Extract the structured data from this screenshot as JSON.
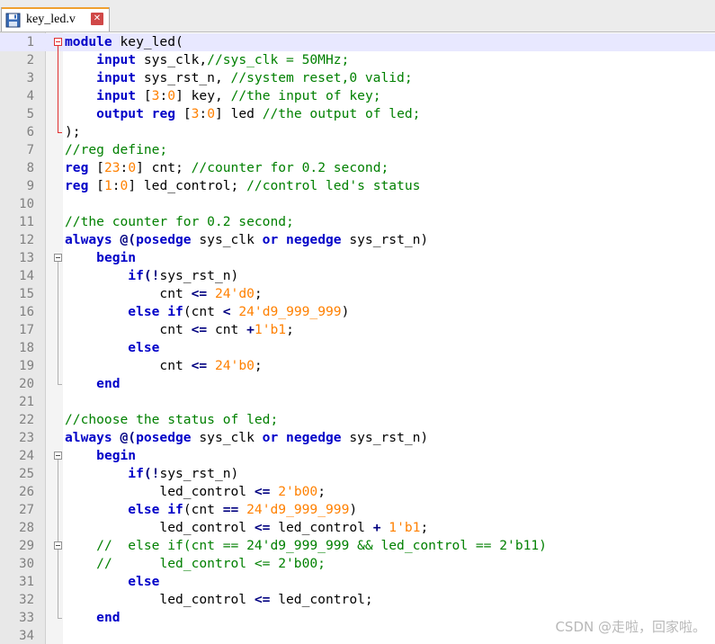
{
  "tab": {
    "file_name": "key_led.v"
  },
  "lines": [
    [
      {
        "t": "module",
        "c": "kw"
      },
      {
        "t": " key_led("
      }
    ],
    [
      {
        "t": "    "
      },
      {
        "t": "input",
        "c": "kw"
      },
      {
        "t": " sys_clk,"
      },
      {
        "t": "//sys_clk = 50MHz;",
        "c": "cm"
      }
    ],
    [
      {
        "t": "    "
      },
      {
        "t": "input",
        "c": "kw"
      },
      {
        "t": " sys_rst_n, "
      },
      {
        "t": "//system reset,0 valid;",
        "c": "cm"
      }
    ],
    [
      {
        "t": "    "
      },
      {
        "t": "input",
        "c": "kw"
      },
      {
        "t": " ["
      },
      {
        "t": "3",
        "c": "nm"
      },
      {
        "t": ":"
      },
      {
        "t": "0",
        "c": "nm"
      },
      {
        "t": "] key, "
      },
      {
        "t": "//the input of key;",
        "c": "cm"
      }
    ],
    [
      {
        "t": "    "
      },
      {
        "t": "output",
        "c": "kw"
      },
      {
        "t": " "
      },
      {
        "t": "reg",
        "c": "kw"
      },
      {
        "t": " ["
      },
      {
        "t": "3",
        "c": "nm"
      },
      {
        "t": ":"
      },
      {
        "t": "0",
        "c": "nm"
      },
      {
        "t": "] led "
      },
      {
        "t": "//the output of led;",
        "c": "cm"
      }
    ],
    [
      {
        "t": ");"
      }
    ],
    [
      {
        "t": "//reg define;",
        "c": "cm"
      }
    ],
    [
      {
        "t": "reg",
        "c": "kw"
      },
      {
        "t": " ["
      },
      {
        "t": "23",
        "c": "nm"
      },
      {
        "t": ":"
      },
      {
        "t": "0",
        "c": "nm"
      },
      {
        "t": "] cnt; "
      },
      {
        "t": "//counter for 0.2 second;",
        "c": "cm"
      }
    ],
    [
      {
        "t": "reg",
        "c": "kw"
      },
      {
        "t": " ["
      },
      {
        "t": "1",
        "c": "nm"
      },
      {
        "t": ":"
      },
      {
        "t": "0",
        "c": "nm"
      },
      {
        "t": "] led_control; "
      },
      {
        "t": "//control led's status",
        "c": "cm"
      }
    ],
    [],
    [
      {
        "t": "//the counter for 0.2 second;",
        "c": "cm"
      }
    ],
    [
      {
        "t": "always",
        "c": "kw"
      },
      {
        "t": " @(",
        "c": "op"
      },
      {
        "t": "posedge",
        "c": "kw"
      },
      {
        "t": " sys_clk "
      },
      {
        "t": "or",
        "c": "kw"
      },
      {
        "t": " "
      },
      {
        "t": "negedge",
        "c": "kw"
      },
      {
        "t": " sys_rst_n)"
      }
    ],
    [
      {
        "t": "    "
      },
      {
        "t": "begin",
        "c": "kw"
      }
    ],
    [
      {
        "t": "        "
      },
      {
        "t": "if",
        "c": "kw"
      },
      {
        "t": "(!",
        "c": "op"
      },
      {
        "t": "sys_rst_n)"
      }
    ],
    [
      {
        "t": "            cnt "
      },
      {
        "t": "<=",
        "c": "op"
      },
      {
        "t": " "
      },
      {
        "t": "24'd0",
        "c": "nm"
      },
      {
        "t": ";"
      }
    ],
    [
      {
        "t": "        "
      },
      {
        "t": "else",
        "c": "kw"
      },
      {
        "t": " "
      },
      {
        "t": "if",
        "c": "kw"
      },
      {
        "t": "(cnt "
      },
      {
        "t": "<",
        "c": "op"
      },
      {
        "t": " "
      },
      {
        "t": "24'd9_999_999",
        "c": "nm"
      },
      {
        "t": ")"
      }
    ],
    [
      {
        "t": "            cnt "
      },
      {
        "t": "<=",
        "c": "op"
      },
      {
        "t": " cnt "
      },
      {
        "t": "+",
        "c": "op"
      },
      {
        "t": "1'b1",
        "c": "nm"
      },
      {
        "t": ";"
      }
    ],
    [
      {
        "t": "        "
      },
      {
        "t": "else",
        "c": "kw"
      }
    ],
    [
      {
        "t": "            cnt "
      },
      {
        "t": "<=",
        "c": "op"
      },
      {
        "t": " "
      },
      {
        "t": "24'b0",
        "c": "nm"
      },
      {
        "t": ";"
      }
    ],
    [
      {
        "t": "    "
      },
      {
        "t": "end",
        "c": "kw"
      }
    ],
    [],
    [
      {
        "t": "//choose the status of led;",
        "c": "cm"
      }
    ],
    [
      {
        "t": "always",
        "c": "kw"
      },
      {
        "t": " @(",
        "c": "op"
      },
      {
        "t": "posedge",
        "c": "kw"
      },
      {
        "t": " sys_clk "
      },
      {
        "t": "or",
        "c": "kw"
      },
      {
        "t": " "
      },
      {
        "t": "negedge",
        "c": "kw"
      },
      {
        "t": " sys_rst_n)"
      }
    ],
    [
      {
        "t": "    "
      },
      {
        "t": "begin",
        "c": "kw"
      }
    ],
    [
      {
        "t": "        "
      },
      {
        "t": "if",
        "c": "kw"
      },
      {
        "t": "(!",
        "c": "op"
      },
      {
        "t": "sys_rst_n)"
      }
    ],
    [
      {
        "t": "            led_control "
      },
      {
        "t": "<=",
        "c": "op"
      },
      {
        "t": " "
      },
      {
        "t": "2'b00",
        "c": "nm"
      },
      {
        "t": ";"
      }
    ],
    [
      {
        "t": "        "
      },
      {
        "t": "else",
        "c": "kw"
      },
      {
        "t": " "
      },
      {
        "t": "if",
        "c": "kw"
      },
      {
        "t": "(cnt "
      },
      {
        "t": "==",
        "c": "op"
      },
      {
        "t": " "
      },
      {
        "t": "24'd9_999_999",
        "c": "nm"
      },
      {
        "t": ")"
      }
    ],
    [
      {
        "t": "            led_control "
      },
      {
        "t": "<=",
        "c": "op"
      },
      {
        "t": " led_control "
      },
      {
        "t": "+",
        "c": "op"
      },
      {
        "t": " "
      },
      {
        "t": "1'b1",
        "c": "nm"
      },
      {
        "t": ";"
      }
    ],
    [
      {
        "t": "    "
      },
      {
        "t": "//  else if(cnt == 24'd9_999_999 && led_control == 2'b11)",
        "c": "cm"
      }
    ],
    [
      {
        "t": "    "
      },
      {
        "t": "//      led_control <= 2'b00;",
        "c": "cm"
      }
    ],
    [
      {
        "t": "        "
      },
      {
        "t": "else",
        "c": "kw"
      }
    ],
    [
      {
        "t": "            led_control "
      },
      {
        "t": "<=",
        "c": "op"
      },
      {
        "t": " led_control;"
      }
    ],
    [
      {
        "t": "    "
      },
      {
        "t": "end",
        "c": "kw"
      }
    ],
    []
  ],
  "current_line": 1,
  "watermark": "CSDN @走啦，回家啦。",
  "colors": {
    "keyword": "#0000c8",
    "comment": "#008000",
    "number": "#ff8000",
    "current_line_bg": "#e8e8ff",
    "fold_marker_active": "#e03030"
  }
}
